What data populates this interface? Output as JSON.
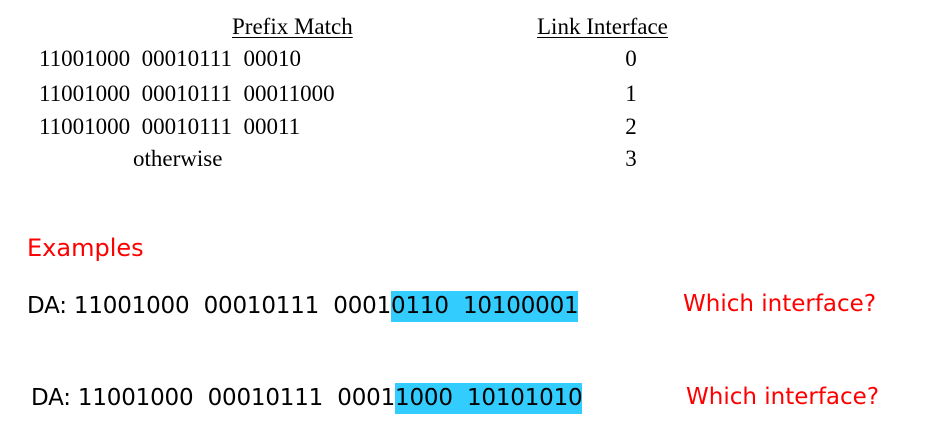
{
  "table": {
    "header_prefix": "Prefix Match",
    "header_interface": "Link Interface",
    "rows": [
      {
        "prefix": "11001000  00010111  00010",
        "interface": "0"
      },
      {
        "prefix": "11001000  00010111  00011000",
        "interface": "1"
      },
      {
        "prefix": "11001000  00010111  00011",
        "interface": "2"
      },
      {
        "prefix": "otherwise",
        "interface": "3"
      }
    ]
  },
  "examples": {
    "title": "Examples",
    "items": [
      {
        "label": "DA: ",
        "plain": "11001000  00010111  0001",
        "highlighted": "0110  10100001",
        "question": "Which interface?"
      },
      {
        "label": "DA: ",
        "plain": "11001000  00010111  0001",
        "highlighted": "1000  10101010",
        "question": "Which interface?"
      }
    ]
  },
  "colors": {
    "highlight": "#33ccff",
    "accent_text": "#ff0000"
  }
}
